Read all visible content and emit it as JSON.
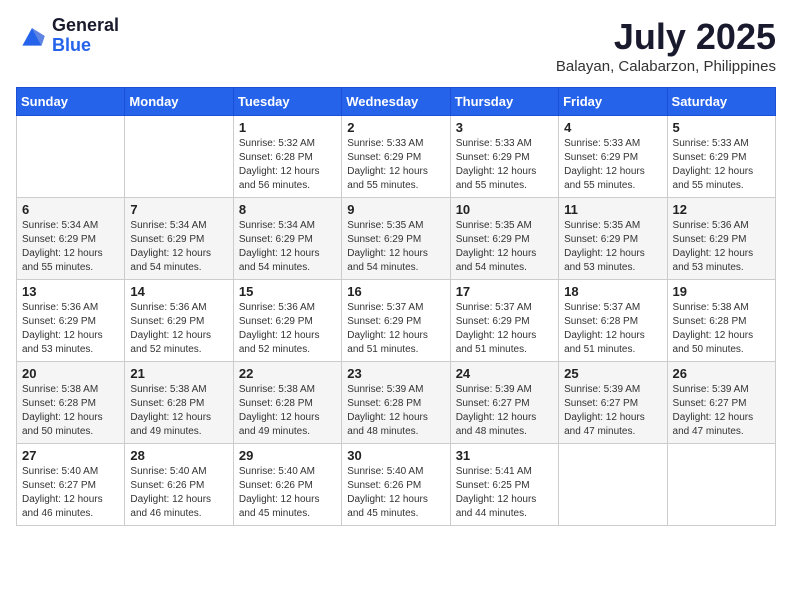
{
  "header": {
    "logo_general": "General",
    "logo_blue": "Blue",
    "month_title": "July 2025",
    "location": "Balayan, Calabarzon, Philippines"
  },
  "days_of_week": [
    "Sunday",
    "Monday",
    "Tuesday",
    "Wednesday",
    "Thursday",
    "Friday",
    "Saturday"
  ],
  "weeks": [
    [
      {
        "day": "",
        "sunrise": "",
        "sunset": "",
        "daylight": ""
      },
      {
        "day": "",
        "sunrise": "",
        "sunset": "",
        "daylight": ""
      },
      {
        "day": "1",
        "sunrise": "Sunrise: 5:32 AM",
        "sunset": "Sunset: 6:28 PM",
        "daylight": "Daylight: 12 hours and 56 minutes."
      },
      {
        "day": "2",
        "sunrise": "Sunrise: 5:33 AM",
        "sunset": "Sunset: 6:29 PM",
        "daylight": "Daylight: 12 hours and 55 minutes."
      },
      {
        "day": "3",
        "sunrise": "Sunrise: 5:33 AM",
        "sunset": "Sunset: 6:29 PM",
        "daylight": "Daylight: 12 hours and 55 minutes."
      },
      {
        "day": "4",
        "sunrise": "Sunrise: 5:33 AM",
        "sunset": "Sunset: 6:29 PM",
        "daylight": "Daylight: 12 hours and 55 minutes."
      },
      {
        "day": "5",
        "sunrise": "Sunrise: 5:33 AM",
        "sunset": "Sunset: 6:29 PM",
        "daylight": "Daylight: 12 hours and 55 minutes."
      }
    ],
    [
      {
        "day": "6",
        "sunrise": "Sunrise: 5:34 AM",
        "sunset": "Sunset: 6:29 PM",
        "daylight": "Daylight: 12 hours and 55 minutes."
      },
      {
        "day": "7",
        "sunrise": "Sunrise: 5:34 AM",
        "sunset": "Sunset: 6:29 PM",
        "daylight": "Daylight: 12 hours and 54 minutes."
      },
      {
        "day": "8",
        "sunrise": "Sunrise: 5:34 AM",
        "sunset": "Sunset: 6:29 PM",
        "daylight": "Daylight: 12 hours and 54 minutes."
      },
      {
        "day": "9",
        "sunrise": "Sunrise: 5:35 AM",
        "sunset": "Sunset: 6:29 PM",
        "daylight": "Daylight: 12 hours and 54 minutes."
      },
      {
        "day": "10",
        "sunrise": "Sunrise: 5:35 AM",
        "sunset": "Sunset: 6:29 PM",
        "daylight": "Daylight: 12 hours and 54 minutes."
      },
      {
        "day": "11",
        "sunrise": "Sunrise: 5:35 AM",
        "sunset": "Sunset: 6:29 PM",
        "daylight": "Daylight: 12 hours and 53 minutes."
      },
      {
        "day": "12",
        "sunrise": "Sunrise: 5:36 AM",
        "sunset": "Sunset: 6:29 PM",
        "daylight": "Daylight: 12 hours and 53 minutes."
      }
    ],
    [
      {
        "day": "13",
        "sunrise": "Sunrise: 5:36 AM",
        "sunset": "Sunset: 6:29 PM",
        "daylight": "Daylight: 12 hours and 53 minutes."
      },
      {
        "day": "14",
        "sunrise": "Sunrise: 5:36 AM",
        "sunset": "Sunset: 6:29 PM",
        "daylight": "Daylight: 12 hours and 52 minutes."
      },
      {
        "day": "15",
        "sunrise": "Sunrise: 5:36 AM",
        "sunset": "Sunset: 6:29 PM",
        "daylight": "Daylight: 12 hours and 52 minutes."
      },
      {
        "day": "16",
        "sunrise": "Sunrise: 5:37 AM",
        "sunset": "Sunset: 6:29 PM",
        "daylight": "Daylight: 12 hours and 51 minutes."
      },
      {
        "day": "17",
        "sunrise": "Sunrise: 5:37 AM",
        "sunset": "Sunset: 6:29 PM",
        "daylight": "Daylight: 12 hours and 51 minutes."
      },
      {
        "day": "18",
        "sunrise": "Sunrise: 5:37 AM",
        "sunset": "Sunset: 6:28 PM",
        "daylight": "Daylight: 12 hours and 51 minutes."
      },
      {
        "day": "19",
        "sunrise": "Sunrise: 5:38 AM",
        "sunset": "Sunset: 6:28 PM",
        "daylight": "Daylight: 12 hours and 50 minutes."
      }
    ],
    [
      {
        "day": "20",
        "sunrise": "Sunrise: 5:38 AM",
        "sunset": "Sunset: 6:28 PM",
        "daylight": "Daylight: 12 hours and 50 minutes."
      },
      {
        "day": "21",
        "sunrise": "Sunrise: 5:38 AM",
        "sunset": "Sunset: 6:28 PM",
        "daylight": "Daylight: 12 hours and 49 minutes."
      },
      {
        "day": "22",
        "sunrise": "Sunrise: 5:38 AM",
        "sunset": "Sunset: 6:28 PM",
        "daylight": "Daylight: 12 hours and 49 minutes."
      },
      {
        "day": "23",
        "sunrise": "Sunrise: 5:39 AM",
        "sunset": "Sunset: 6:28 PM",
        "daylight": "Daylight: 12 hours and 48 minutes."
      },
      {
        "day": "24",
        "sunrise": "Sunrise: 5:39 AM",
        "sunset": "Sunset: 6:27 PM",
        "daylight": "Daylight: 12 hours and 48 minutes."
      },
      {
        "day": "25",
        "sunrise": "Sunrise: 5:39 AM",
        "sunset": "Sunset: 6:27 PM",
        "daylight": "Daylight: 12 hours and 47 minutes."
      },
      {
        "day": "26",
        "sunrise": "Sunrise: 5:39 AM",
        "sunset": "Sunset: 6:27 PM",
        "daylight": "Daylight: 12 hours and 47 minutes."
      }
    ],
    [
      {
        "day": "27",
        "sunrise": "Sunrise: 5:40 AM",
        "sunset": "Sunset: 6:27 PM",
        "daylight": "Daylight: 12 hours and 46 minutes."
      },
      {
        "day": "28",
        "sunrise": "Sunrise: 5:40 AM",
        "sunset": "Sunset: 6:26 PM",
        "daylight": "Daylight: 12 hours and 46 minutes."
      },
      {
        "day": "29",
        "sunrise": "Sunrise: 5:40 AM",
        "sunset": "Sunset: 6:26 PM",
        "daylight": "Daylight: 12 hours and 45 minutes."
      },
      {
        "day": "30",
        "sunrise": "Sunrise: 5:40 AM",
        "sunset": "Sunset: 6:26 PM",
        "daylight": "Daylight: 12 hours and 45 minutes."
      },
      {
        "day": "31",
        "sunrise": "Sunrise: 5:41 AM",
        "sunset": "Sunset: 6:25 PM",
        "daylight": "Daylight: 12 hours and 44 minutes."
      },
      {
        "day": "",
        "sunrise": "",
        "sunset": "",
        "daylight": ""
      },
      {
        "day": "",
        "sunrise": "",
        "sunset": "",
        "daylight": ""
      }
    ]
  ]
}
